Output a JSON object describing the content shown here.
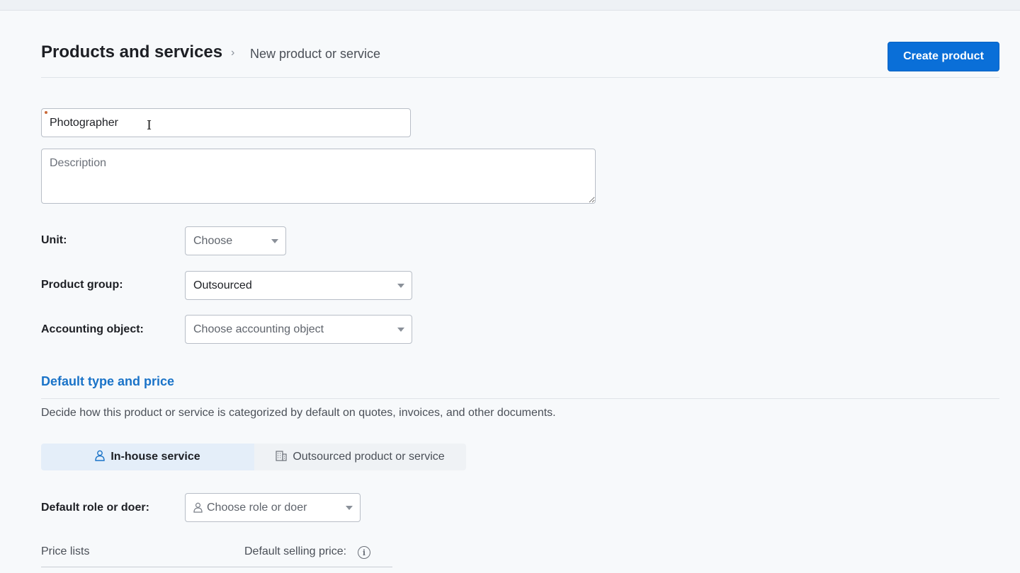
{
  "header": {
    "title": "Products and services",
    "breadcrumb_separator": "›",
    "breadcrumb_current": "New product or service",
    "create_button": "Create product"
  },
  "form": {
    "name_value": "Photographer",
    "description_placeholder": "Description",
    "unit": {
      "label": "Unit:",
      "value": "Choose"
    },
    "product_group": {
      "label": "Product group:",
      "value": "Outsourced"
    },
    "accounting_object": {
      "label": "Accounting object:",
      "value": "Choose accounting object"
    }
  },
  "default_type": {
    "title": "Default type and price",
    "description": "Decide how this product or service is categorized by default on quotes, invoices, and other documents.",
    "options": [
      {
        "label": "In-house service",
        "icon": "person-icon",
        "selected": true
      },
      {
        "label": "Outsourced product or service",
        "icon": "building-icon",
        "selected": false
      }
    ],
    "role": {
      "label": "Default role or doer:",
      "placeholder": "Choose role or doer"
    },
    "price_lists_label": "Price lists",
    "default_selling_price_label": "Default selling price:"
  },
  "colors": {
    "accent": "#0a6fd8",
    "section_title": "#1a73c8",
    "segment_active": "#e4eef9"
  }
}
